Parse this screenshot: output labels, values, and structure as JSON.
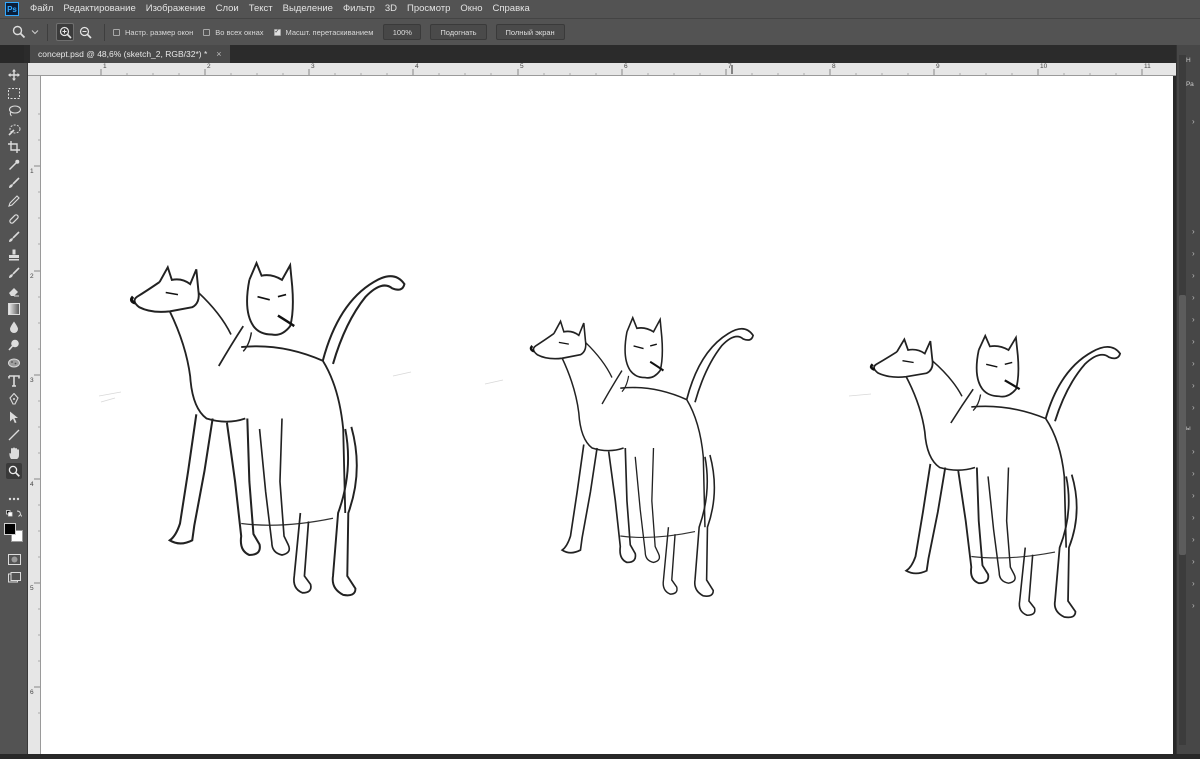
{
  "app": {
    "logo": "Ps",
    "menu": [
      "Файл",
      "Редактирование",
      "Изображение",
      "Слои",
      "Текст",
      "Выделение",
      "Фильтр",
      "3D",
      "Просмотр",
      "Окно",
      "Справка"
    ]
  },
  "options_bar": {
    "tool_icon": "zoom-icon",
    "resize_windows": "Настр. размер окон",
    "all_windows": "Во всех окнах",
    "scrubby_zoom": "Масшт. перетаскиванием",
    "zoom_value": "100%",
    "fit_screen": "Подогнать",
    "fill_screen": "Полный экран",
    "checks": {
      "resize_windows": false,
      "all_windows": false,
      "scrubby_zoom": true
    }
  },
  "document": {
    "tab_title": "concept.psd @ 48,6% (sketch_2, RGB/32*) *",
    "close": "×"
  },
  "rulers": {
    "top": [
      "1",
      "2",
      "3",
      "4",
      "5",
      "6",
      "7",
      "8",
      "9",
      "10",
      "11"
    ],
    "left": [
      "1",
      "2",
      "3",
      "4",
      "5",
      "6"
    ]
  },
  "tools": [
    "move-icon",
    "marquee-icon",
    "lasso-icon",
    "quick-select-icon",
    "crop-icon",
    "eyedropper-icon",
    "brush-icon",
    "pencil-icon",
    "clone-stamp-icon",
    "history-brush-icon",
    "stamp-icon",
    "mixer-brush-icon",
    "eraser-icon",
    "gradient-icon",
    "blur-icon",
    "dodge-icon",
    "sponge-icon",
    "type-icon",
    "pen-icon",
    "path-select-icon",
    "line-icon",
    "hand-icon",
    "zoom-icon",
    "more-tools-icon"
  ],
  "right_panel": {
    "labels": [
      "Н",
      "Ра",
      "ы"
    ],
    "arrows": [
      "›",
      "›",
      "›",
      "›",
      "›",
      "›",
      "›",
      "›",
      "›",
      "›",
      "›",
      "›",
      "›",
      "›",
      "›",
      "›",
      "›",
      "›"
    ]
  }
}
